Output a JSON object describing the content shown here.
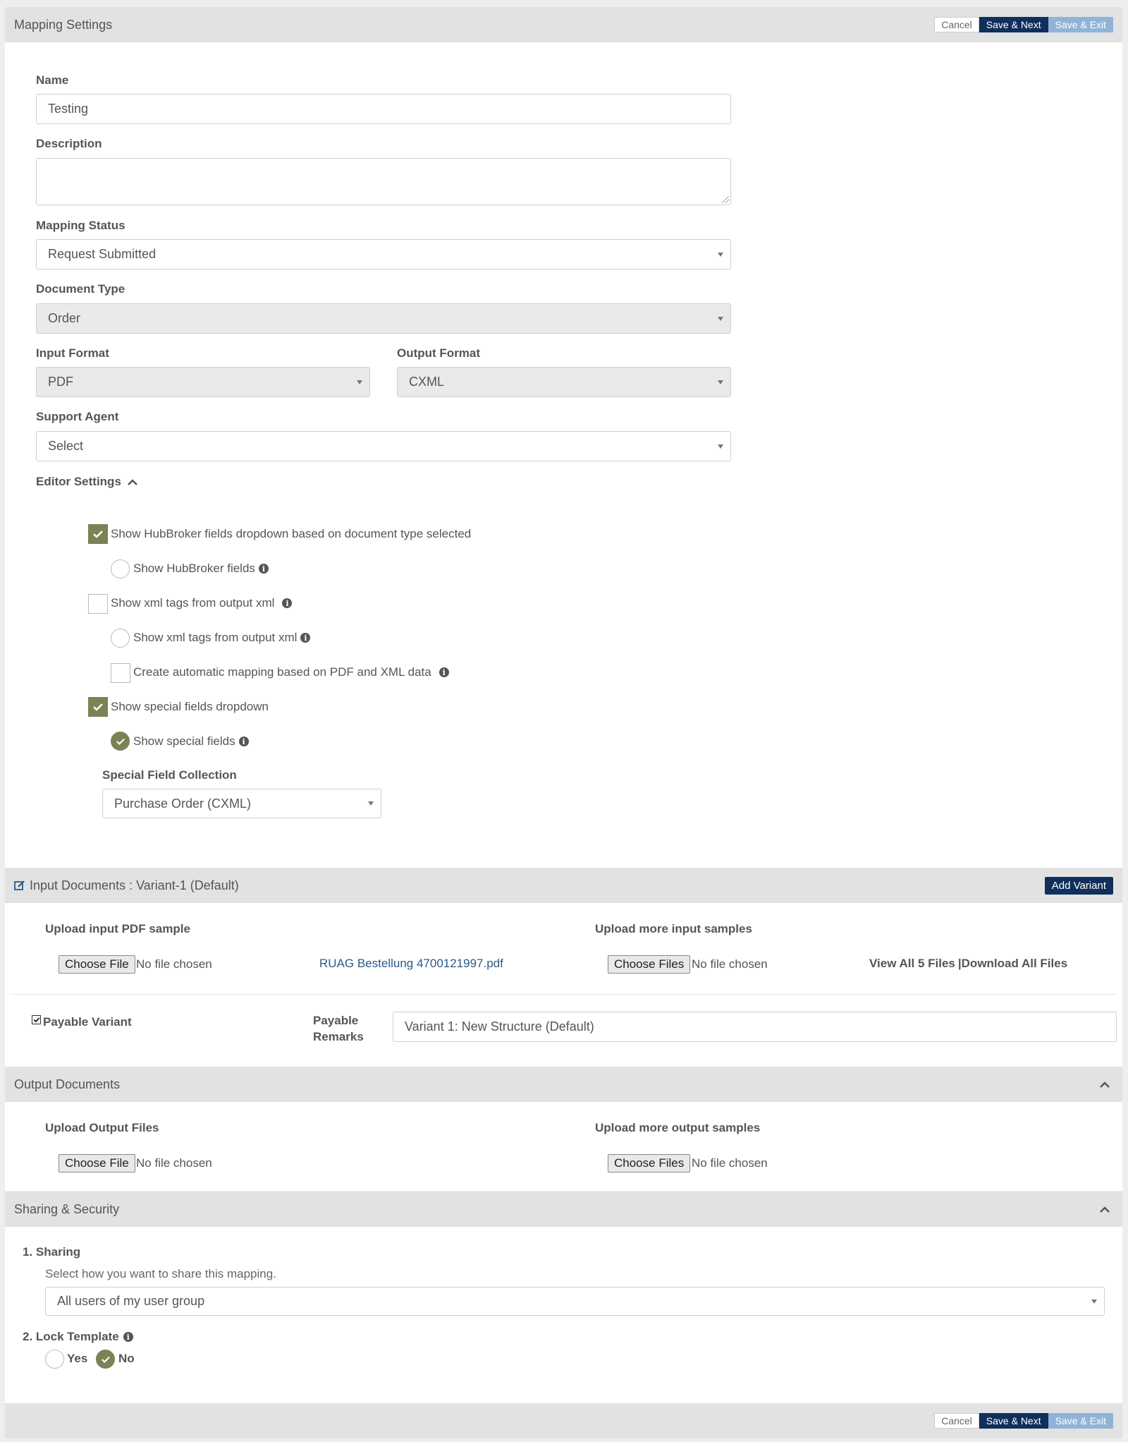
{
  "header": {
    "title": "Mapping Settings",
    "cancel": "Cancel",
    "save_next": "Save & Next",
    "save_exit": "Save & Exit"
  },
  "form": {
    "name_label": "Name",
    "name_value": "Testing",
    "description_label": "Description",
    "description_value": "",
    "status_label": "Mapping Status",
    "status_value": "Request Submitted",
    "doctype_label": "Document Type",
    "doctype_value": "Order",
    "input_format_label": "Input Format",
    "input_format_value": "PDF",
    "output_format_label": "Output Format",
    "output_format_value": "CXML",
    "agent_label": "Support Agent",
    "agent_value": "Select"
  },
  "editor": {
    "title": "Editor Settings",
    "opt1": {
      "label": "Show HubBroker fields dropdown based on document type selected",
      "checked": true
    },
    "opt1a": {
      "label": "Show HubBroker fields",
      "checked": false
    },
    "opt2": {
      "label": "Show xml tags from output xml",
      "checked": false
    },
    "opt2a": {
      "label": "Show xml tags from output xml",
      "checked": false
    },
    "opt2b": {
      "label": "Create automatic mapping based on PDF and XML data",
      "checked": false
    },
    "opt3": {
      "label": "Show special fields dropdown",
      "checked": true
    },
    "opt3a": {
      "label": "Show special fields",
      "checked": true
    },
    "collection_label": "Special Field Collection",
    "collection_value": "Purchase Order (CXML)"
  },
  "input_docs": {
    "title": "Input Documents : Variant-1 (Default)",
    "add_variant": "Add Variant",
    "upload_pdf_label": "Upload input PDF sample",
    "choose_file": "Choose File",
    "no_file": "No file chosen",
    "file_link": "RUAG Bestellung 4700121997.pdf",
    "upload_more_label": "Upload more input samples",
    "choose_files": "Choose Files",
    "view_all": "View All 5 Files",
    "separator": "|",
    "download_all": "Download All Files",
    "payable_variant": "Payable Variant",
    "payable_remarks_1": "Payable",
    "payable_remarks_2": "Remarks",
    "remarks_value": "Variant 1: New Structure (Default)"
  },
  "output_docs": {
    "title": "Output Documents",
    "upload_label": "Upload Output Files",
    "choose_file": "Choose File",
    "no_file": "No file chosen",
    "upload_more_label": "Upload more output samples",
    "choose_files": "Choose Files"
  },
  "sharing": {
    "title": "Sharing & Security",
    "sharing_label": "1. Sharing",
    "sharing_hint": "Select how you want to share this mapping.",
    "sharing_value": "All users of my user group",
    "lock_label": "2. Lock Template",
    "yes": "Yes",
    "no": "No",
    "lock_selected": "No"
  },
  "footer": {
    "cancel": "Cancel",
    "save_next": "Save & Next",
    "save_exit": "Save & Exit"
  },
  "colors": {
    "primary": "#0f2f5c",
    "secondary": "#8fb4d8",
    "check": "#7a8256",
    "link": "#2a5a86"
  }
}
